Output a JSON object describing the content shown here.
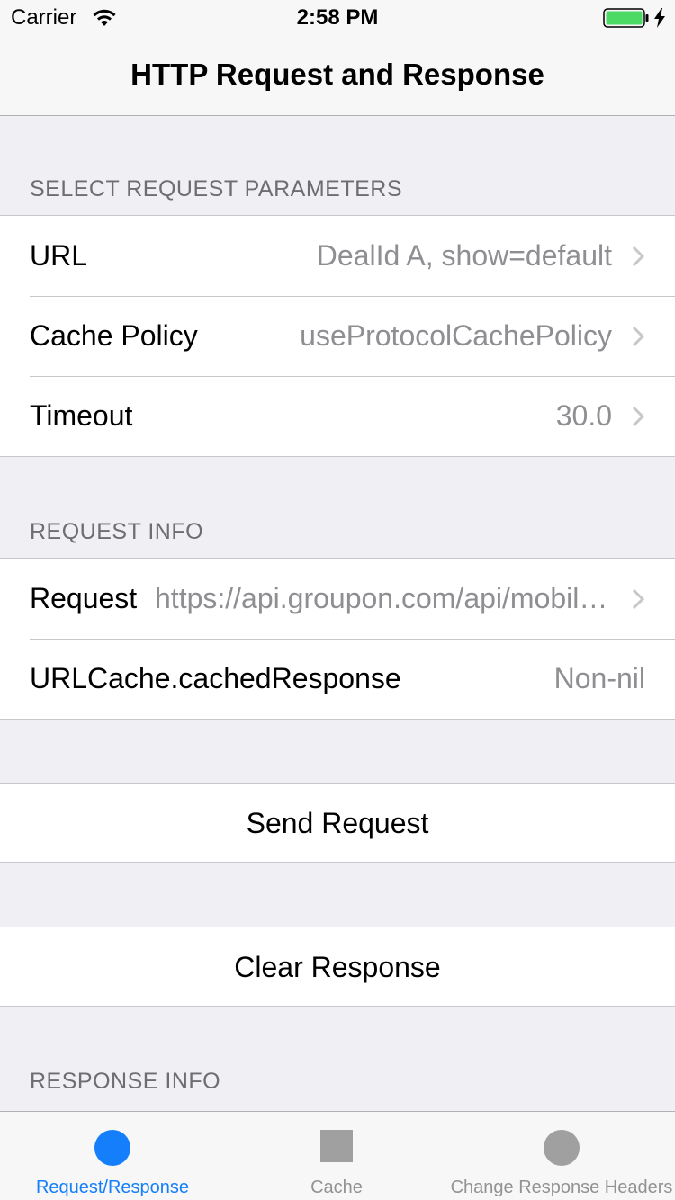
{
  "status_bar": {
    "carrier": "Carrier",
    "time": "2:58 PM",
    "battery_color": "#4cd964"
  },
  "nav": {
    "title": "HTTP Request and Response"
  },
  "sections": {
    "request_params": {
      "header": "SELECT REQUEST PARAMETERS",
      "rows": [
        {
          "label": "URL",
          "value": "DealId A, show=default"
        },
        {
          "label": "Cache Policy",
          "value": "useProtocolCachePolicy"
        },
        {
          "label": "Timeout",
          "value": "30.0"
        }
      ]
    },
    "request_info": {
      "header": "REQUEST INFO",
      "rows": [
        {
          "label": "Request",
          "value": "https://api.groupon.com/api/mobile/deals"
        },
        {
          "label": "URLCache.cachedResponse",
          "value": "Non-nil"
        }
      ]
    },
    "actions": {
      "send": "Send Request",
      "clear": "Clear Response"
    },
    "response_info": {
      "header": "RESPONSE INFO"
    }
  },
  "tab_bar": {
    "active_color": "#147efb",
    "inactive_color": "#929292",
    "tabs": [
      {
        "label": "Request/Response",
        "icon": "circle-icon",
        "active": true
      },
      {
        "label": "Cache",
        "icon": "square-icon",
        "active": false
      },
      {
        "label": "Change Response Headers",
        "icon": "circle-icon",
        "active": false
      }
    ]
  }
}
